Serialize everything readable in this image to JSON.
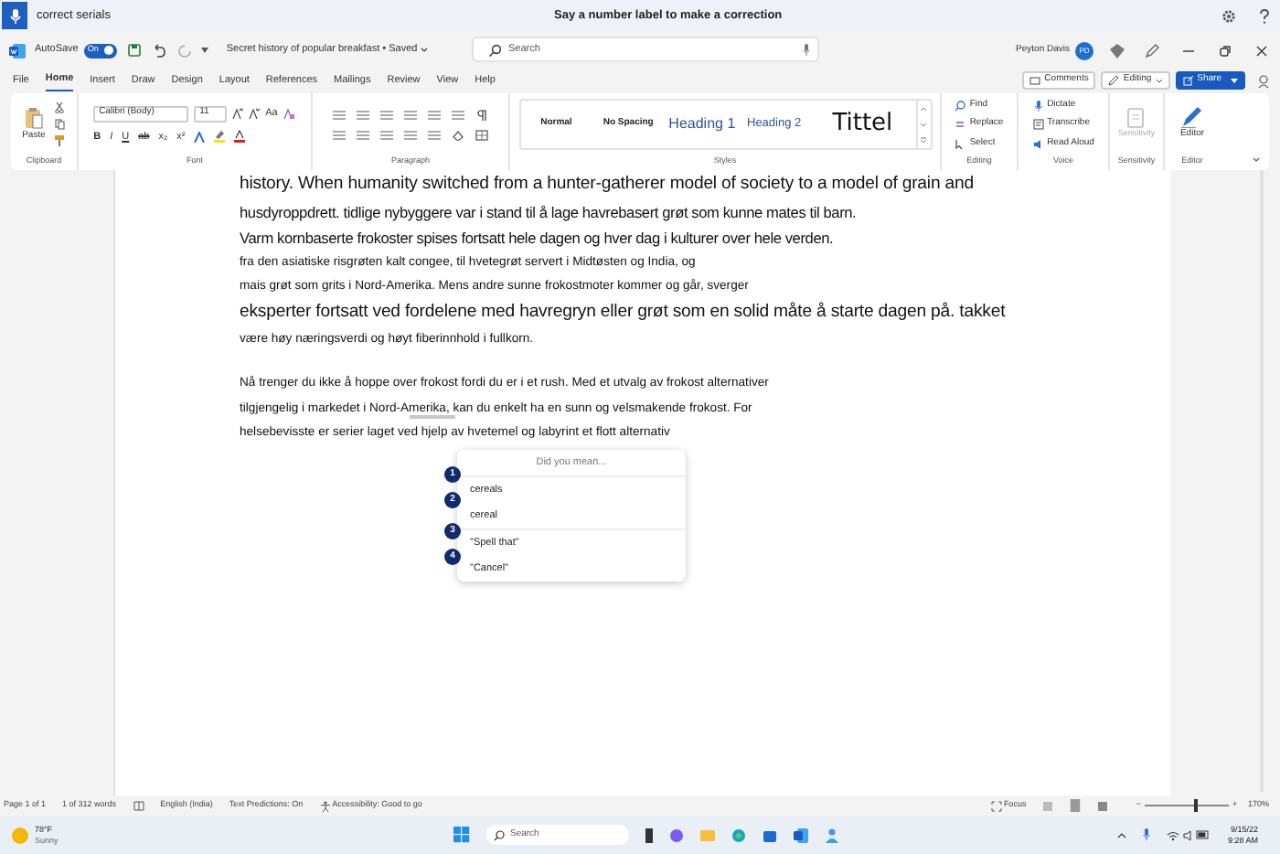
{
  "voice_bar": {
    "query": "correct serials",
    "hint": "Say a number label to make a correction"
  },
  "title_bar": {
    "autosave_label": "AutoSave",
    "autosave_on": true,
    "autosave_state": "On",
    "document_title": "Secret history of popular breakfast • Saved",
    "search_placeholder": "Search",
    "user_name": "Peyton Davis",
    "user_initials": "PD"
  },
  "tabs": [
    {
      "label": "File",
      "selected": false
    },
    {
      "label": "Home",
      "selected": true
    },
    {
      "label": "Insert",
      "selected": false
    },
    {
      "label": "Draw",
      "selected": false
    },
    {
      "label": "Design",
      "selected": false
    },
    {
      "label": "Layout",
      "selected": false
    },
    {
      "label": "References",
      "selected": false
    },
    {
      "label": "Mailings",
      "selected": false
    },
    {
      "label": "Review",
      "selected": false
    },
    {
      "label": "View",
      "selected": false
    },
    {
      "label": "Help",
      "selected": false
    }
  ],
  "ribbon_actions": {
    "comments": "Comments",
    "editing": "Editing",
    "share": "Share"
  },
  "ribbon": {
    "clipboard": {
      "paste": "Paste",
      "group": "Clipboard"
    },
    "font": {
      "font_name": "Calibri (Body)",
      "font_size": "11",
      "change_case": "Aa",
      "format_glyphs": [
        "B",
        "I",
        "U",
        "ab",
        "x₂",
        "x²"
      ],
      "group": "Font"
    },
    "paragraph": {
      "group": "Paragraph"
    },
    "styles": {
      "items": [
        {
          "label": "Normal",
          "kind": "normal"
        },
        {
          "label": "No Spacing",
          "kind": "normal"
        },
        {
          "label": "Heading 1",
          "kind": "heading1"
        },
        {
          "label": "Heading 2",
          "kind": "heading2"
        },
        {
          "label": "Tittel",
          "kind": "title"
        }
      ],
      "group": "Styles"
    },
    "editing": {
      "items": [
        "Find",
        "Replace",
        "Select"
      ],
      "group": "Editing"
    },
    "voice": {
      "items": [
        "Dictate",
        "Transcribe",
        "Read Aloud"
      ],
      "group": "Voice"
    },
    "sensitivity": {
      "label": "Sensitivity",
      "disabled": true,
      "group": "Sensitivity"
    },
    "editor": {
      "label": "Editor",
      "group": "Editor"
    }
  },
  "document": {
    "paragraphs": [
      {
        "lines": [
          {
            "text": "history. When humanity switched from a hunter-gatherer model of society to a model of grain and",
            "kind": "large"
          },
          {
            "text": "husdyroppdrett. tidlige nybyggere var i stand til å lage havrebasert grøt som kunne mates til barn.",
            "kind": "medium"
          },
          {
            "text": "Varm kornbaserte frokoster spises fortsatt hele dagen og hver dag i kulturer over hele verden.",
            "kind": "medium"
          },
          {
            "text": "fra den asiatiske risgrøten kalt congee, til hvetegrøt servert i Midtøsten og India, og",
            "kind": "small"
          },
          {
            "text": "mais grøt som grits i Nord-Amerika. Mens andre sunne frokostmoter kommer og går, sverger",
            "kind": "small"
          },
          {
            "text": "eksperter fortsatt ved fordelene med havregryn eller grøt som en solid måte å starte dagen på. takket",
            "kind": "large"
          },
          {
            "text": "være høy næringsverdi og høyt fiberinnhold i fullkorn.",
            "kind": "small"
          }
        ]
      },
      {
        "lines": [
          {
            "text": "Nå trenger du ikke å hoppe over frokost fordi du er i et rush. Med et utvalg av frokost alternativer",
            "kind": "small"
          },
          {
            "text": "tilgjengelig i markedet i Nord-Amerika, kan du enkelt ha en sunn og velsmakende frokost. For",
            "kind": "small"
          },
          {
            "text": "helsebevisste er serier laget ved hjelp av hvetemel og labyrint et flott alternativ",
            "kind": "small"
          }
        ]
      }
    ]
  },
  "suggestions": {
    "title": "Did you mean...",
    "items": [
      {
        "number": "1",
        "label": "cereals"
      },
      {
        "number": "2",
        "label": "cereal"
      },
      {
        "number": "3",
        "label": "\"Spell that\""
      },
      {
        "number": "4",
        "label": "\"Cancel\""
      }
    ]
  },
  "status_bar": {
    "page": "Page 1 of 1",
    "words": "1 of 312 words",
    "language": "English (India)",
    "predictions": "Text Predictions: On",
    "accessibility": "Accessibility: Good to go",
    "focus": "Focus",
    "zoom_out": "−",
    "zoom_in": "+",
    "zoom": {
      "level": 0.62
    },
    "zoom_percent": "170%"
  },
  "taskbar": {
    "temperature": "78°F",
    "weather": "Sunny",
    "search_placeholder": "Search",
    "date": "9/15/22",
    "time": "9:28 AM"
  }
}
